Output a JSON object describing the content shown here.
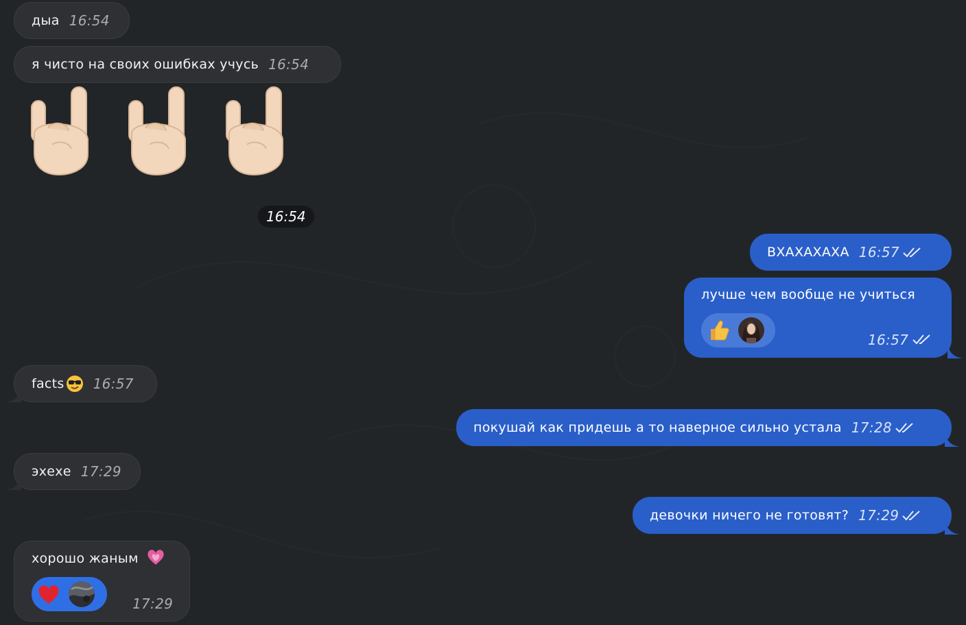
{
  "messages": [
    {
      "side": "in",
      "text": "дыа",
      "time": "16:54"
    },
    {
      "side": "in",
      "text": "я чисто на своих ошибках учусь",
      "time": "16:54"
    },
    {
      "side": "in",
      "kind": "emoji",
      "emoji": [
        "rock-on-hand",
        "rock-on-hand",
        "rock-on-hand"
      ],
      "time": "16:54"
    },
    {
      "side": "out",
      "text": "ВХАХАХАХА",
      "time": "16:57",
      "status": "read"
    },
    {
      "side": "out",
      "text": "лучше чем вообще не учиться",
      "time": "16:57",
      "status": "read",
      "reaction": "thumbs-up"
    },
    {
      "side": "in",
      "text": "facts",
      "emoji": "sunglasses-face",
      "time": "16:57"
    },
    {
      "side": "out",
      "text": "покушай как придешь а то наверное сильно устала",
      "time": "17:28",
      "status": "read"
    },
    {
      "side": "in",
      "text": "эхехе",
      "time": "17:29"
    },
    {
      "side": "out",
      "text": "девочки ничего не готовят?",
      "time": "17:29",
      "status": "read"
    },
    {
      "side": "in",
      "text": "хорошо жаным",
      "emoji": "sparkling-heart",
      "time": "17:29",
      "reaction": "red-heart"
    }
  ],
  "colors": {
    "background": "#222528",
    "incoming_bubble": "#2e3034",
    "outgoing_bubble": "#2a5fc9",
    "time_incoming": "#a9acb2",
    "time_outgoing": "#d9e3f7"
  }
}
